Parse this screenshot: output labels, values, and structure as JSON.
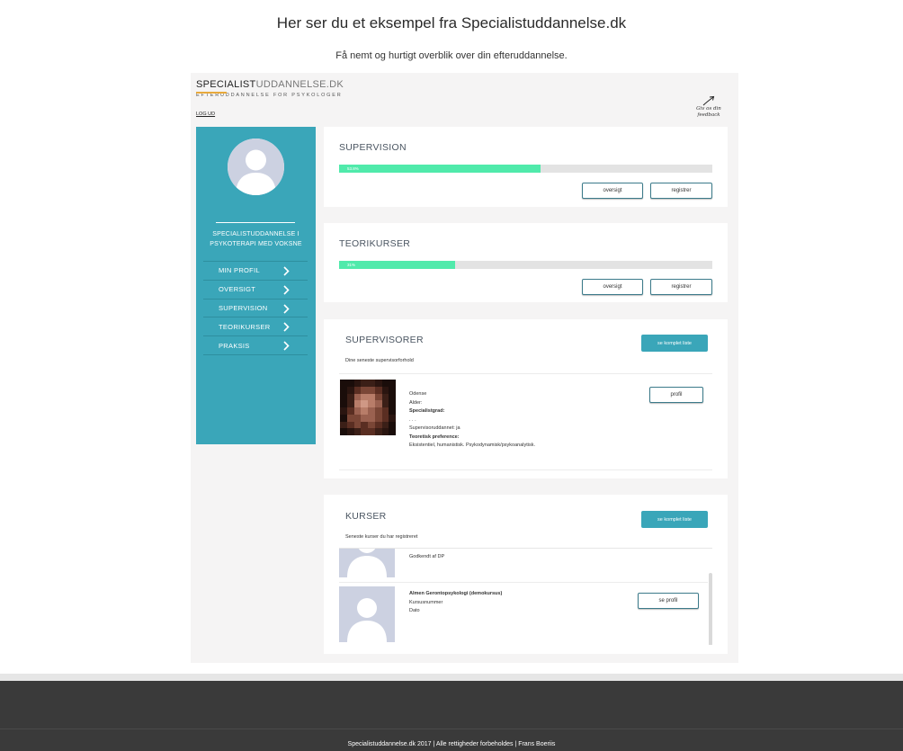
{
  "page": {
    "title": "Her ser du et eksempel fra Specialistuddannelse.dk",
    "subtitle": "Få nemt og hurtigt overblik over din efteruddannelse."
  },
  "app": {
    "brand_bold": "SPECIALIST",
    "brand_light": "UDDANNELSE.DK",
    "brand_tagline": "EFTERUDDANNELSE FOR PSYKOLOGER",
    "logout": "LOG UD",
    "feedback_line1": "Giv os din",
    "feedback_line2": "feedback"
  },
  "sidebar": {
    "heading_line1": "SPECIALISTUDDANNELSE I",
    "heading_line2": "PSYKOTERAPI MED VOKSNE",
    "items": [
      {
        "label": "MIN PROFIL"
      },
      {
        "label": "OVERSIGT"
      },
      {
        "label": "SUPERVISION"
      },
      {
        "label": "TEORIKURSER"
      },
      {
        "label": "PRAKSIS"
      }
    ]
  },
  "supervision": {
    "title": "SUPERVISION",
    "progress": 0.54,
    "progress_label": "53.8%",
    "btn_overview": "oversigt",
    "btn_register": "registrer"
  },
  "teorikurser": {
    "title": "TEORIKURSER",
    "progress": 0.31,
    "progress_label": "31%",
    "btn_overview": "oversigt",
    "btn_register": "registrer"
  },
  "supervisorer": {
    "title": "SUPERVISORER",
    "btn_list": "se komplet liste",
    "caption": "Dine seneste supervisorforhold",
    "entry": {
      "city": "Odense",
      "age": "Alder:",
      "degree_label": "Specialistgrad:",
      "degree_value": ". . .",
      "education": "Supervisoruddannet: ja",
      "pref_label": "Teoretisk preference:",
      "pref_value": "Eksistentiel, humanistisk. Psykodynamisk/psykoanalytisk.",
      "btn_profile": "profil"
    }
  },
  "kurser": {
    "title": "KURSER",
    "btn_list": "se komplet liste",
    "caption": "Seneste kurser du har registreret",
    "rows": [
      {
        "line1": "Godkendt af DP"
      },
      {
        "name": "Almen Gerontopsykologi (demokursus)",
        "line2": "Kursusnummer",
        "line3": "Dato",
        "btn_profile": "se profil"
      }
    ]
  },
  "footer": {
    "text": "Specialistuddannelse.dk 2017 | Alle rettigheder forbeholdes | Frans Boeriis"
  },
  "colors": {
    "teal": "#3aa6b9",
    "progress_green": "#50eaab",
    "footer_bg": "#3a3a3a"
  }
}
